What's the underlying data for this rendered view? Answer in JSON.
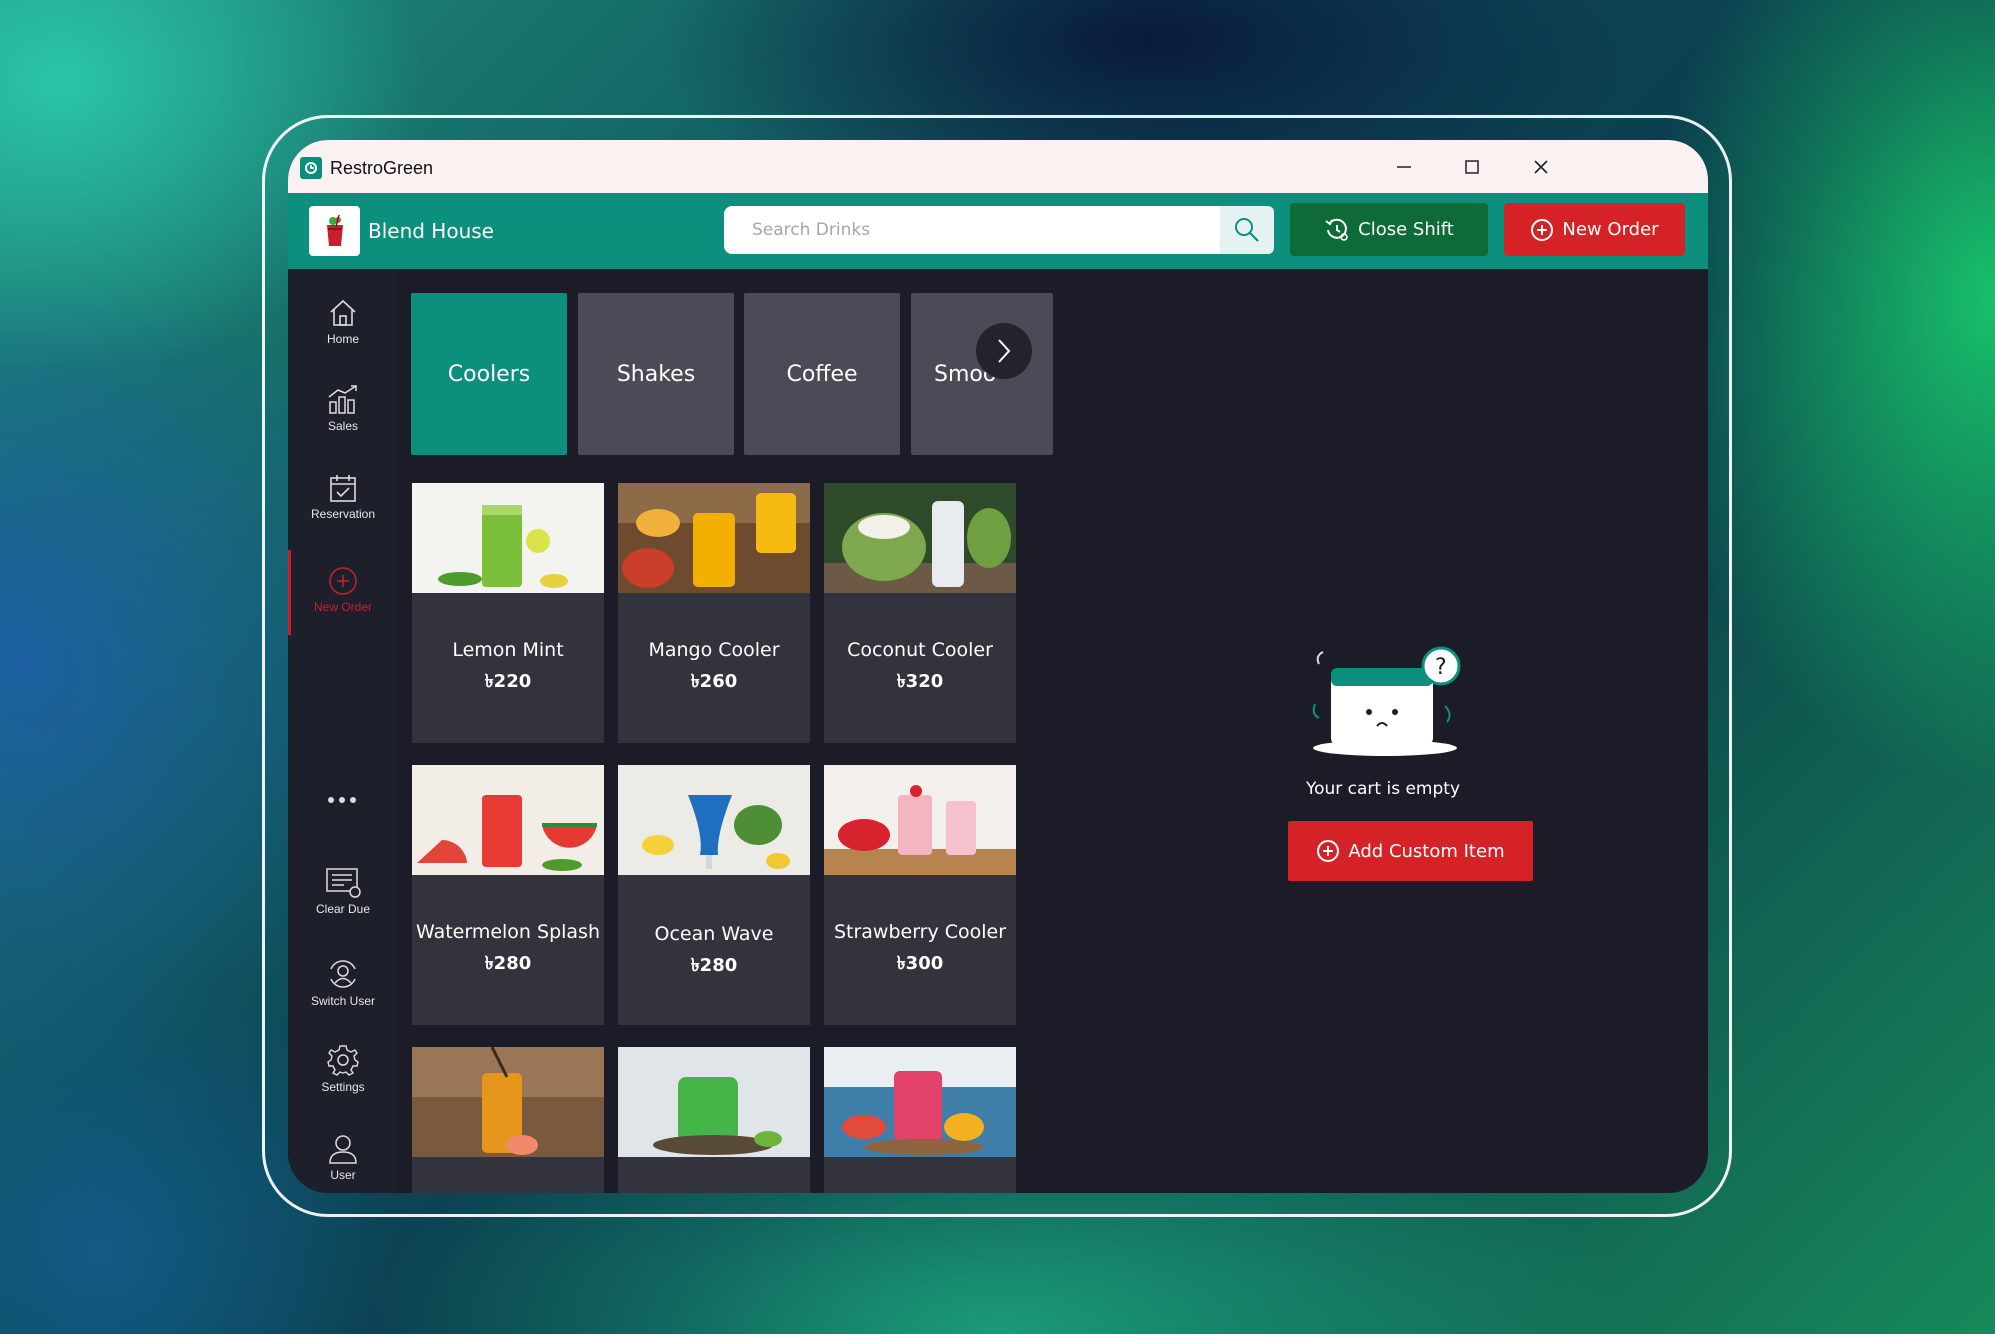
{
  "window": {
    "title": "RestroGreen"
  },
  "header": {
    "brand_name": "Blend House",
    "search_placeholder": "Search Drinks",
    "close_shift_label": "Close Shift",
    "new_order_label": "New Order"
  },
  "sidebar": {
    "items": [
      {
        "label": "Home",
        "icon": "home-icon"
      },
      {
        "label": "Sales",
        "icon": "sales-chart-icon"
      },
      {
        "label": "Reservation",
        "icon": "calendar-check-icon"
      },
      {
        "label": "New Order",
        "icon": "plus-circle-icon",
        "active": true
      },
      {
        "label": "Clear Due",
        "icon": "receipt-icon"
      },
      {
        "label": "Switch User",
        "icon": "switch-user-icon"
      },
      {
        "label": "Settings",
        "icon": "gear-icon"
      },
      {
        "label": "User",
        "icon": "user-icon"
      }
    ],
    "more_icon": "more-dots-icon"
  },
  "categories": [
    {
      "label": "Coolers",
      "active": true
    },
    {
      "label": "Shakes"
    },
    {
      "label": "Coffee"
    },
    {
      "label": "Smoo"
    }
  ],
  "products": [
    {
      "name": "Lemon Mint",
      "price": "৳220"
    },
    {
      "name": "Mango Cooler",
      "price": "৳260"
    },
    {
      "name": "Coconut Cooler",
      "price": "৳320"
    },
    {
      "name": "Watermelon Splash",
      "price": "৳280"
    },
    {
      "name": "Ocean Wave",
      "price": "৳280"
    },
    {
      "name": "Strawberry Cooler",
      "price": "৳300"
    },
    {
      "name": "",
      "price": ""
    },
    {
      "name": "",
      "price": ""
    },
    {
      "name": "",
      "price": ""
    }
  ],
  "cart": {
    "empty_text": "Your cart is empty",
    "add_custom_label": "Add Custom Item"
  },
  "colors": {
    "teal": "#0c8f7c",
    "red": "#d42226",
    "dark_green": "#0e6a36",
    "panel": "#1b1c27"
  }
}
